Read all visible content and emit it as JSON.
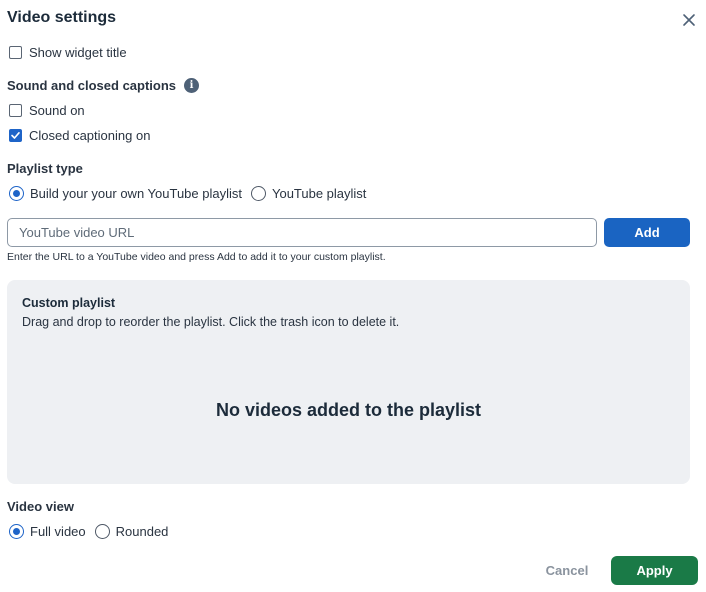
{
  "dialog": {
    "title": "Video settings",
    "close_icon": "close-icon"
  },
  "show_widget_title": {
    "label": "Show widget title",
    "checked": false
  },
  "sound_section": {
    "label": "Sound and closed captions",
    "info_icon": "info-icon",
    "info_glyph": "i",
    "sound_on": {
      "label": "Sound on",
      "checked": false
    },
    "closed_captioning": {
      "label": "Closed captioning on",
      "checked": true
    }
  },
  "playlist_type": {
    "label": "Playlist type",
    "options": [
      {
        "label": "Build your your own YouTube playlist",
        "selected": true
      },
      {
        "label": "YouTube playlist",
        "selected": false
      }
    ]
  },
  "url_input": {
    "placeholder": "YouTube video URL",
    "value": "",
    "add_label": "Add",
    "helper": "Enter the URL to a YouTube video and press Add to add it to your custom playlist."
  },
  "custom_playlist": {
    "title": "Custom playlist",
    "subtitle": "Drag and drop to reorder the playlist. Click the trash icon to delete it.",
    "empty_message": "No videos added to the playlist"
  },
  "video_view": {
    "label": "Video view",
    "options": [
      {
        "label": "Full video",
        "selected": true
      },
      {
        "label": "Rounded",
        "selected": false
      }
    ]
  },
  "footer": {
    "cancel_label": "Cancel",
    "apply_label": "Apply"
  },
  "colors": {
    "accent": "#1e64c8",
    "add_button": "#1a64c2",
    "apply_button": "#1a7a47",
    "playlist_bg": "#eef0f3"
  }
}
